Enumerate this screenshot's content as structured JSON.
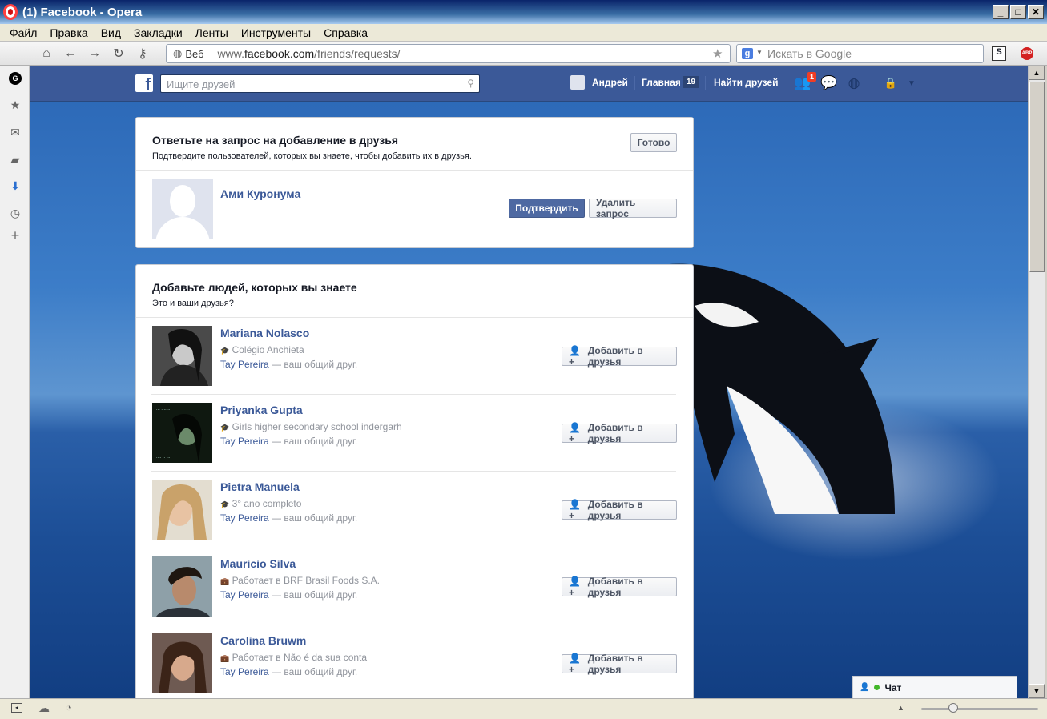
{
  "window": {
    "title": "(1) Facebook - Opera",
    "controls": [
      "_",
      "□",
      "✕"
    ]
  },
  "menu": [
    "Файл",
    "Правка",
    "Вид",
    "Закладки",
    "Ленты",
    "Инструменты",
    "Справка"
  ],
  "toolbar": {
    "web_label": "Веб",
    "url_prefix": "www.",
    "url_domain": "facebook.com",
    "url_path": "/friends/requests/",
    "search_placeholder": "Искать в Google",
    "search_engine_badge": "g"
  },
  "fb": {
    "logo": "f",
    "search_placeholder": "Ищите друзей",
    "user_name": "Андрей",
    "home_label": "Главная",
    "home_count": "19",
    "find_friends": "Найти друзей",
    "friend_requests_badge": "1",
    "icons": [
      "friend-requests-icon",
      "messages-icon",
      "notifications-globe-icon",
      "privacy-lock-icon",
      "settings-arrow-icon"
    ]
  },
  "requests": {
    "title": "Ответьте на запрос на добавление в друзья",
    "subtitle": "Подтвердите пользователей, которых вы знаете, чтобы добавить их в друзья.",
    "done_label": "Готово",
    "items": [
      {
        "name": "Ами Куронума",
        "confirm_label": "Подтвердить",
        "delete_label": "Удалить запрос"
      }
    ]
  },
  "suggestions": {
    "title": "Добавьте людей, которых вы знаете",
    "subtitle": "Это и ваши друзья?",
    "add_label": "Добавить в друзья",
    "mutual_suffix": " — ваш общий друг.",
    "items": [
      {
        "name": "Mariana Nolasco",
        "meta": "Colégio Anchieta",
        "meta_icon": "school-icon",
        "mutual": "Tay Pereira"
      },
      {
        "name": "Priyanka Gupta",
        "meta": "Girls higher secondary school indergarh",
        "meta_icon": "school-icon",
        "mutual": "Tay Pereira"
      },
      {
        "name": "Pietra Manuela",
        "meta": "3° ano completo",
        "meta_icon": "school-icon",
        "mutual": "Tay Pereira"
      },
      {
        "name": "Mauricio Silva",
        "meta": "Работает в BRF Brasil Foods S.A.",
        "meta_icon": "work-icon",
        "mutual": "Tay Pereira"
      },
      {
        "name": "Carolina Bruwm",
        "meta": "Работает в Não é da sua conta",
        "meta_icon": "work-icon",
        "mutual": "Tay Pereira"
      }
    ]
  },
  "chat": {
    "label": "Чат"
  },
  "colors": {
    "fb_blue": "#3b5998",
    "confirm_blue": "#4e69a2",
    "online_green": "#42b72a"
  }
}
